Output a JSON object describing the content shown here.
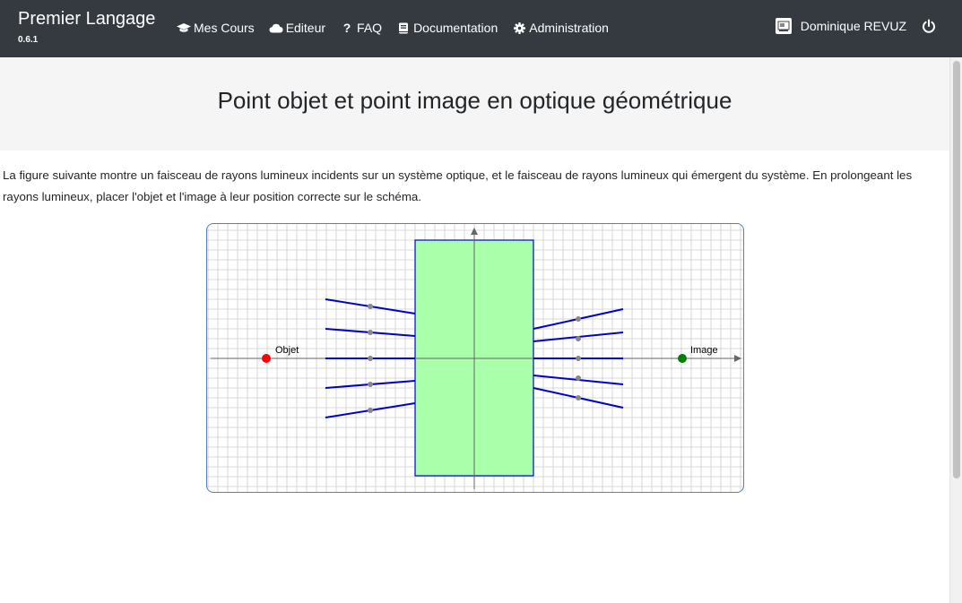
{
  "navbar": {
    "brand": "Premier Langage",
    "version": "0.6.1",
    "links": [
      {
        "label": "Mes Cours",
        "icon": "graduation-cap-icon"
      },
      {
        "label": "Editeur",
        "icon": "cloud-icon"
      },
      {
        "label": "FAQ",
        "icon": "question-icon"
      },
      {
        "label": "Documentation",
        "icon": "book-icon"
      },
      {
        "label": "Administration",
        "icon": "gear-icon"
      }
    ],
    "user": "Dominique REVUZ",
    "avatar_icon": "user-avatar-icon",
    "logout_icon": "power-icon"
  },
  "page": {
    "title": "Point objet et point image en optique géométrique",
    "statement": "La figure suivante montre un faisceau de rayons lumineux incidents sur un système optique, et le faisceau de rayons lumineux qui émergent du système. En prolongeant les rayons lumineux, placer l'objet et l'image à leur position correcte sur le schéma."
  },
  "figure": {
    "object_label": "Objet",
    "image_label": "Image",
    "colors": {
      "object_point": "#ff0000",
      "image_point": "#008000",
      "rays": "#0000cc",
      "system_fill": "#aaffaa",
      "system_stroke": "#0000cc",
      "grid": "#cccccc",
      "axis": "#666666",
      "handles": "#888888"
    }
  }
}
